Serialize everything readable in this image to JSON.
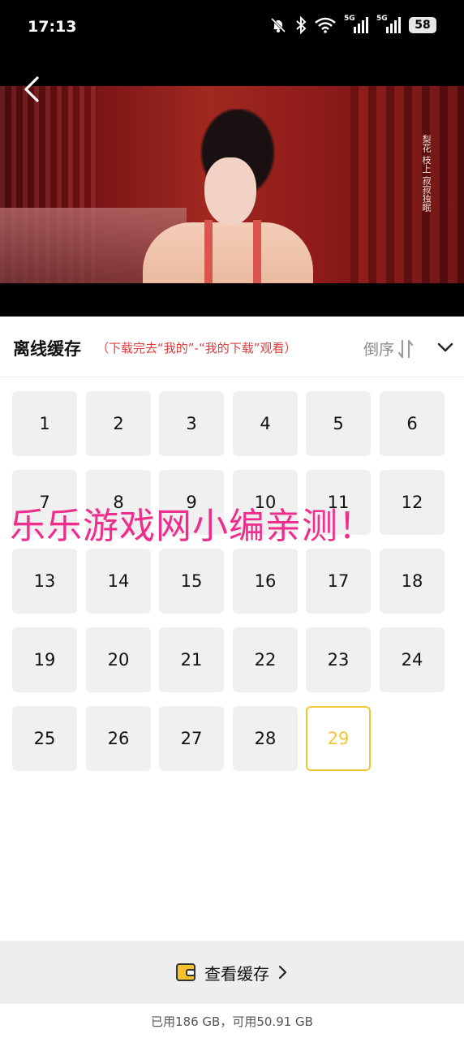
{
  "status_bar": {
    "time": "17:13",
    "network_1": "5G",
    "network_2": "5G",
    "battery": "58",
    "icons": [
      "mute-bell-icon",
      "bluetooth-icon",
      "wifi-icon",
      "signal-icon",
      "signal-icon",
      "battery-icon"
    ]
  },
  "video": {
    "caption": "梨花 枝上 寂寂独眠"
  },
  "header": {
    "title": "离线缓存",
    "hint": "（下载完去“我的”-“我的下载”观看）",
    "sort_label": "倒序",
    "sort_icon": "sort-arrows-icon",
    "collapse_icon": "chevron-down-icon"
  },
  "episodes": [
    "1",
    "2",
    "3",
    "4",
    "5",
    "6",
    "7",
    "8",
    "9",
    "10",
    "11",
    "12",
    "13",
    "14",
    "15",
    "16",
    "17",
    "18",
    "19",
    "20",
    "21",
    "22",
    "23",
    "24",
    "25",
    "26",
    "27",
    "28",
    "29"
  ],
  "active_episode": "29",
  "colors": {
    "accent": "#f2c533",
    "hint": "#e03c3c",
    "watermark": "#ee2d8c"
  },
  "watermark": "乐乐游戏网小编亲测！",
  "bottom": {
    "view_cache_label": "查看缓存",
    "icon": "wallet-icon"
  },
  "storage": {
    "text": "已用186 GB，可用50.91 GB"
  }
}
